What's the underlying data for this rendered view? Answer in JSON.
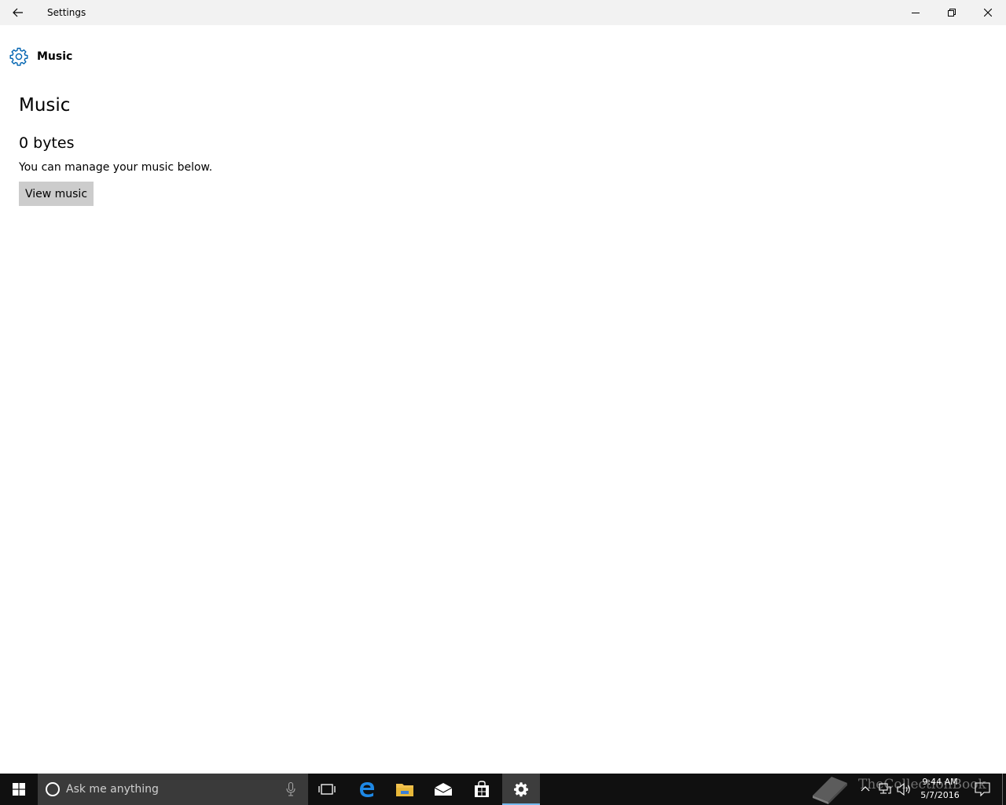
{
  "window": {
    "title": "Settings",
    "back_icon": "arrow-left-icon",
    "minimize_icon": "minimize-icon",
    "restore_icon": "restore-icon",
    "close_icon": "close-icon"
  },
  "header": {
    "icon": "gear-icon",
    "title": "Music"
  },
  "main": {
    "title": "Music",
    "size": "0 bytes",
    "description": "You can manage your music below.",
    "view_button_label": "View music"
  },
  "taskbar": {
    "search_placeholder": "Ask me anything",
    "apps": [
      "task-view",
      "microsoft-edge",
      "file-explorer",
      "mail",
      "store",
      "settings"
    ],
    "active_app": "settings",
    "clock_time": "9:44 AM",
    "clock_date": "5/7/2016"
  },
  "watermark": {
    "text": "TheCollectionBook"
  },
  "colors": {
    "accent": "#0063b1",
    "titlebar_bg": "#f2f2f2",
    "taskbar_bg": "#101010",
    "button_bg": "#cccccc"
  }
}
